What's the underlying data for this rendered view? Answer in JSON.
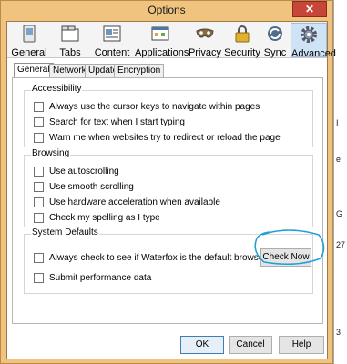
{
  "window": {
    "title": "Options",
    "close_glyph": "✕"
  },
  "toolbar": {
    "items": [
      {
        "label": "General",
        "icon": "general-icon",
        "selected": false
      },
      {
        "label": "Tabs",
        "icon": "tabs-icon",
        "selected": false
      },
      {
        "label": "Content",
        "icon": "content-icon",
        "selected": false
      },
      {
        "label": "Applications",
        "icon": "applications-icon",
        "selected": false
      },
      {
        "label": "Privacy",
        "icon": "privacy-mask-icon",
        "selected": false
      },
      {
        "label": "Security",
        "icon": "padlock-icon",
        "selected": false
      },
      {
        "label": "Sync",
        "icon": "sync-icon",
        "selected": false
      },
      {
        "label": "Advanced",
        "icon": "gear-icon",
        "selected": true
      }
    ]
  },
  "subtabs": [
    {
      "label": "General",
      "active": true
    },
    {
      "label": "Network",
      "active": false
    },
    {
      "label": "Update",
      "active": false
    },
    {
      "label": "Encryption",
      "active": false
    }
  ],
  "accessibility": {
    "title": "Accessibility",
    "items": [
      {
        "label": "Always use the cursor keys to navigate within pages",
        "checked": false
      },
      {
        "label": "Search for text when I start typing",
        "checked": false
      },
      {
        "label": "Warn me when websites try to redirect or reload the page",
        "checked": false
      }
    ]
  },
  "browsing": {
    "title": "Browsing",
    "items": [
      {
        "label": "Use autoscrolling",
        "checked": false
      },
      {
        "label": "Use smooth scrolling",
        "checked": false
      },
      {
        "label": "Use hardware acceleration when available",
        "checked": false
      },
      {
        "label": "Check my spelling as I type",
        "checked": false
      }
    ]
  },
  "system_defaults": {
    "title": "System Defaults",
    "items": [
      {
        "label": "Always check to see if Waterfox is the default browser on startup",
        "checked": false
      },
      {
        "label": "Submit performance data",
        "checked": false
      }
    ],
    "check_now": "Check Now"
  },
  "footer": {
    "ok": "OK",
    "cancel": "Cancel",
    "help": "Help"
  },
  "background_fragments": [
    "I",
    "e",
    "G",
    "27",
    "3"
  ],
  "colors": {
    "accent": "#3c7fb1",
    "annotation": "#1fa0d8",
    "frame": "#f0c37f"
  }
}
